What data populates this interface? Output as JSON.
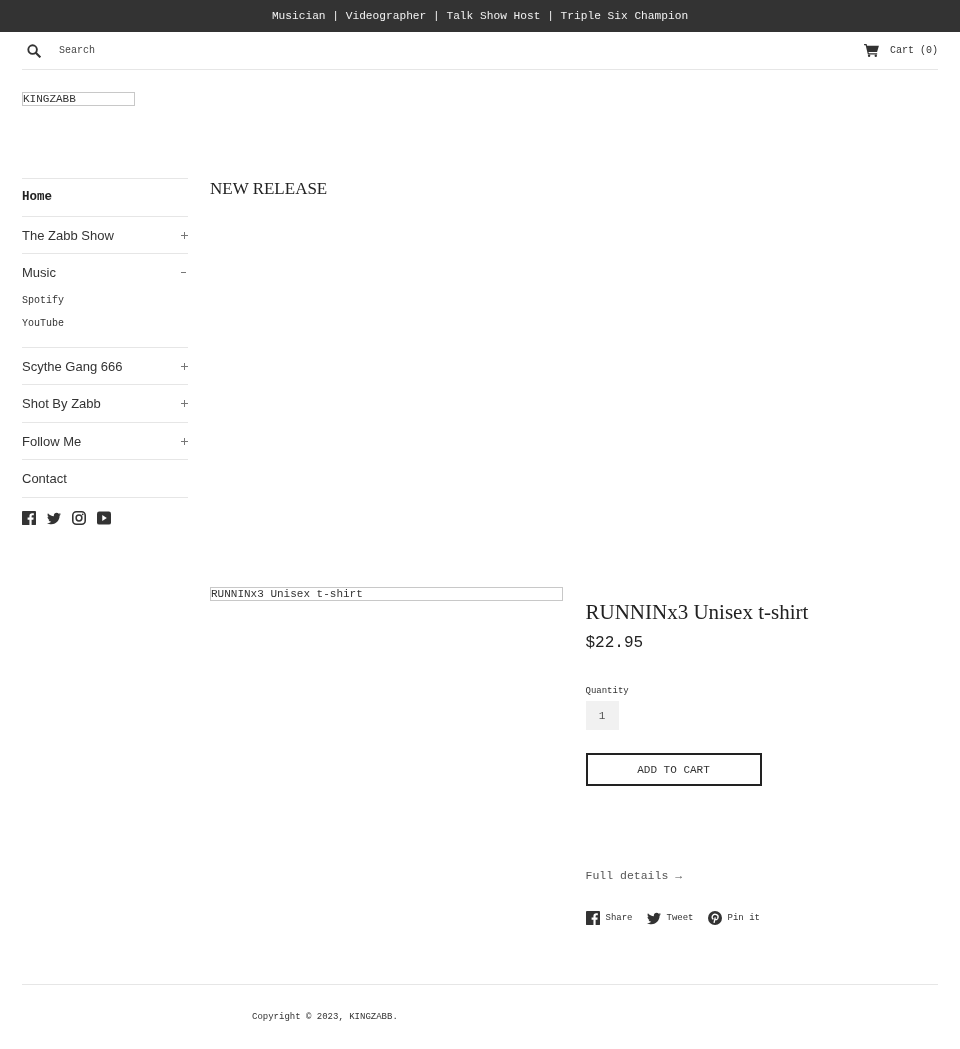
{
  "announcement": {
    "text": "Musician | Videographer | Talk Show Host | Triple Six Champion"
  },
  "header": {
    "search": {
      "placeholder": "Search"
    },
    "cart": {
      "label": "Cart (0)"
    }
  },
  "logo": {
    "alt_text": "KINGZABB"
  },
  "sidebar": {
    "items": [
      {
        "label": "Home",
        "selected": true
      },
      {
        "label": "The Zabb Show",
        "selected": false,
        "expanded": false
      },
      {
        "label": "Music",
        "selected": false,
        "expanded": true,
        "children": [
          {
            "label": "Spotify",
            "selected": false
          },
          {
            "label": "YouTube",
            "selected": false
          }
        ]
      },
      {
        "label": "Scythe Gang 666",
        "selected": false,
        "expanded": false
      },
      {
        "label": "Shot By Zabb",
        "selected": false,
        "expanded": false
      },
      {
        "label": "Follow Me",
        "selected": false,
        "expanded": false
      },
      {
        "label": "Contact",
        "selected": false
      }
    ]
  },
  "main": {
    "heading": "NEW RELEASE"
  },
  "product": {
    "image_alt_text": "RUNNINx3 Unisex t-shirt",
    "title": "RUNNINx3 Unisex t-shirt",
    "price": "$22.95",
    "quantity": {
      "label": "Quantity",
      "value": "1"
    },
    "add_to_cart": "ADD TO CART",
    "details_link": "Full details →",
    "share": [
      {
        "label": "Share"
      },
      {
        "label": "Tweet"
      },
      {
        "label": "Pin it"
      }
    ]
  },
  "footer": {
    "copyright": "Copyright © 2023, KINGZABB."
  }
}
